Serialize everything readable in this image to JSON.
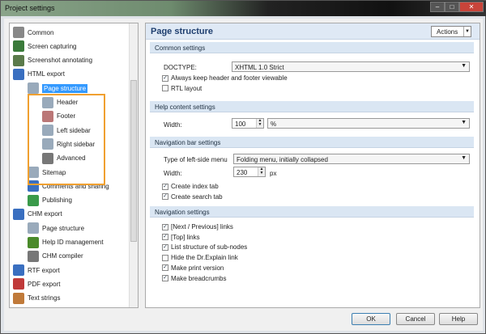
{
  "window": {
    "title": "Project settings"
  },
  "tree": {
    "items": [
      {
        "label": "Common",
        "level": 0,
        "color": "#888"
      },
      {
        "label": "Screen capturing",
        "level": 0,
        "color": "#3a7a3a"
      },
      {
        "label": "Screenshot annotating",
        "level": 0,
        "color": "#5a7a4a"
      },
      {
        "label": "HTML export",
        "level": 0,
        "color": "#3a6fc0"
      },
      {
        "label": "Page structure",
        "level": 1,
        "color": "#9ab",
        "selected": true
      },
      {
        "label": "Header",
        "level": 2,
        "color": "#9ab"
      },
      {
        "label": "Footer",
        "level": 2,
        "color": "#b77"
      },
      {
        "label": "Left sidebar",
        "level": 2,
        "color": "#9ab"
      },
      {
        "label": "Right sidebar",
        "level": 2,
        "color": "#9ab"
      },
      {
        "label": "Advanced",
        "level": 2,
        "color": "#777"
      },
      {
        "label": "Sitemap",
        "level": 1,
        "color": "#9ab"
      },
      {
        "label": "Comments and sharing",
        "level": 1,
        "color": "#3a6fc0"
      },
      {
        "label": "Publishing",
        "level": 1,
        "color": "#3a9a4a"
      },
      {
        "label": "CHM export",
        "level": 0,
        "color": "#3a6fc0"
      },
      {
        "label": "Page structure",
        "level": 1,
        "color": "#9ab"
      },
      {
        "label": "Help ID management",
        "level": 1,
        "color": "#4a8a2a"
      },
      {
        "label": "CHM compiler",
        "level": 1,
        "color": "#777"
      },
      {
        "label": "RTF export",
        "level": 0,
        "color": "#3a6fc0"
      },
      {
        "label": "PDF export",
        "level": 0,
        "color": "#c03a3a"
      },
      {
        "label": "Text strings",
        "level": 0,
        "color": "#c07a3a"
      }
    ]
  },
  "panel": {
    "title": "Page structure",
    "actions_label": "Actions",
    "common": {
      "heading": "Common settings",
      "doctype_label": "DOCTYPE:",
      "doctype_value": "XHTML 1.0 Strict",
      "checks": [
        {
          "label": "Always keep header and footer viewable",
          "checked": true
        },
        {
          "label": "RTL layout",
          "checked": false
        }
      ]
    },
    "help": {
      "heading": "Help content settings",
      "width_label": "Width:",
      "width_value": "100",
      "unit_value": "%"
    },
    "navbar": {
      "heading": "Navigation bar settings",
      "menu_label": "Type of left-side menu",
      "menu_value": "Folding menu, initially collapsed",
      "width_label": "Width:",
      "width_value": "230",
      "unit": "px",
      "checks": [
        {
          "label": "Create index tab",
          "checked": true
        },
        {
          "label": "Create search tab",
          "checked": true
        }
      ]
    },
    "nav": {
      "heading": "Navigation settings",
      "checks": [
        {
          "label": "[Next / Previous] links",
          "checked": true
        },
        {
          "label": "[Top] links",
          "checked": true
        },
        {
          "label": "List structure of sub-nodes",
          "checked": true
        },
        {
          "label": "Hide the Dr.Explain link",
          "checked": false
        },
        {
          "label": "Make print version",
          "checked": true
        },
        {
          "label": "Make breadcrumbs",
          "checked": true
        }
      ]
    }
  },
  "buttons": {
    "ok": "OK",
    "cancel": "Cancel",
    "help": "Help"
  }
}
